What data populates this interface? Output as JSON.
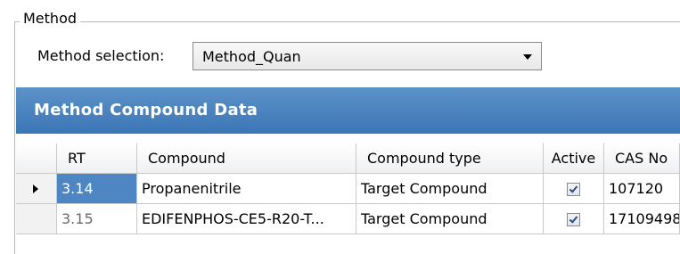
{
  "method_group": {
    "legend": "Method",
    "selection_label": "Method selection:",
    "selected_method": "Method_Quan"
  },
  "panel": {
    "title": "Method Compound Data"
  },
  "table": {
    "columns": [
      "",
      "RT",
      "Compound",
      "Compound type",
      "Active",
      "CAS No"
    ],
    "rows": [
      {
        "rt": "3.14",
        "compound": "Propanenitrile",
        "compound_type": "Target Compound",
        "active": true,
        "cas_no": "107120"
      },
      {
        "rt": "3.15",
        "compound": "EDIFENPHOS-CE5-R20-T...",
        "compound_type": "Target Compound",
        "active": true,
        "cas_no": "17109498"
      }
    ]
  },
  "colors": {
    "header_bg": "#3b76b6",
    "selected_cell": "#4d86c3"
  },
  "icons": {
    "row_indicator": "triangle-right-icon",
    "combo_arrow": "chevron-down-icon",
    "checkbox": "checkbox-checked-icon"
  }
}
